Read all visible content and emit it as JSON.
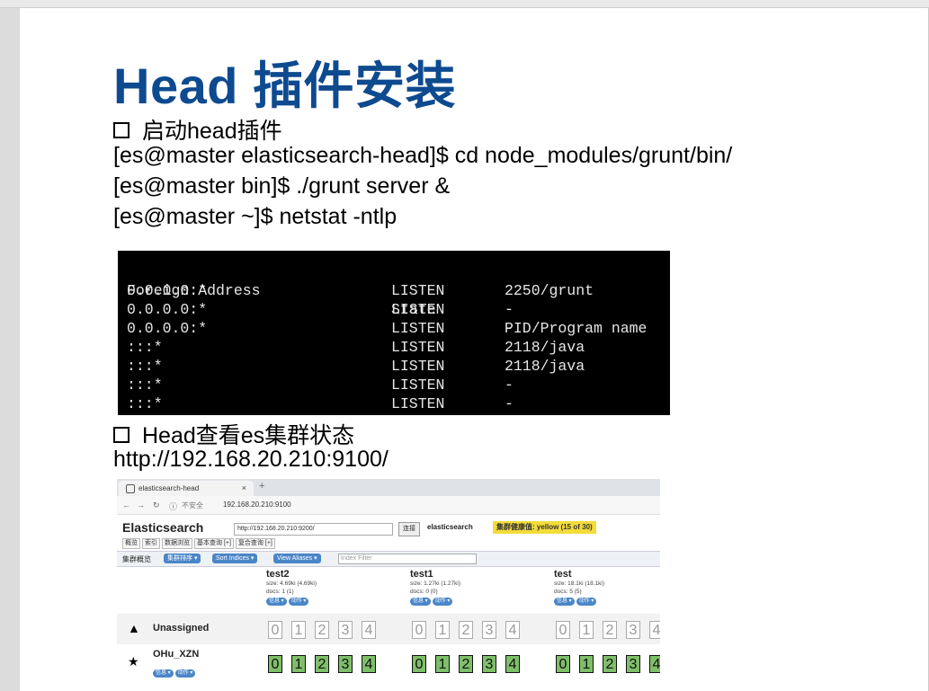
{
  "slide": {
    "title": "Head 插件安装",
    "bullet1": "启动head插件",
    "commands": [
      "[es@master elasticsearch-head]$  cd node_modules/grunt/bin/",
      "[es@master bin]$ ./grunt server &",
      "[es@master ~]$ netstat -ntlp"
    ],
    "bullet2": "Head查看es集群状态",
    "url": "http://192.168.20.210:9100/"
  },
  "terminal": {
    "headers": [
      "Foreign Address",
      "State",
      "PID/Program name"
    ],
    "rows": [
      [
        "0.0.0.0:*",
        "LISTEN",
        "2250/grunt"
      ],
      [
        "0.0.0.0:*",
        "LISTEN",
        "-"
      ],
      [
        "0.0.0.0:*",
        "LISTEN",
        "-"
      ],
      [
        ":::*",
        "LISTEN",
        "2118/java"
      ],
      [
        ":::*",
        "LISTEN",
        "2118/java"
      ],
      [
        ":::*",
        "LISTEN",
        "-"
      ],
      [
        ":::*",
        "LISTEN",
        "-"
      ]
    ]
  },
  "browser": {
    "tab_title": "elasticsearch-head",
    "tab_close": "×",
    "new_tab": "+",
    "insecure": "不安全",
    "address": "192.168.20.210:9100",
    "app_title": "Elasticsearch",
    "connect_url": "http://192.168.20.210:9200/",
    "connect_button": "连接",
    "cluster_name": "elasticsearch",
    "health": "集群健康值: yellow (15 of 30)",
    "subtabs": [
      "概览",
      "索引",
      "数据浏览",
      "基本查询 [+]",
      "复合查询 [+]"
    ],
    "toolbar_label": "集群概览",
    "toolbar_buttons": [
      "集群排序 ▾",
      "Sort Indices ▾",
      "View Aliases ▾"
    ],
    "filter_placeholder": "Index Filter",
    "indices": [
      {
        "name": "test2",
        "size": "size: 4.69ki (4.69ki)",
        "docs": "docs: 1 (1)"
      },
      {
        "name": "test1",
        "size": "size: 1.27ki (1.27ki)",
        "docs": "docs: 0 (0)"
      },
      {
        "name": "test",
        "size": "size: 18.1ki (18.1ki)",
        "docs": "docs: 5 (5)"
      }
    ],
    "index_buttons": [
      "信息 ▾",
      "动作 ▾"
    ],
    "unassigned_label": "Unassigned",
    "node_label": "OHu_XZN",
    "node_buttons": [
      "信息 ▾",
      "动作 ▾"
    ],
    "shards": [
      "0",
      "1",
      "2",
      "3",
      "4"
    ],
    "colors": {
      "shard_assigned": "#7fbf6a",
      "health_yellow": "#f3dc3a",
      "button_blue": "#4a86c8"
    }
  }
}
